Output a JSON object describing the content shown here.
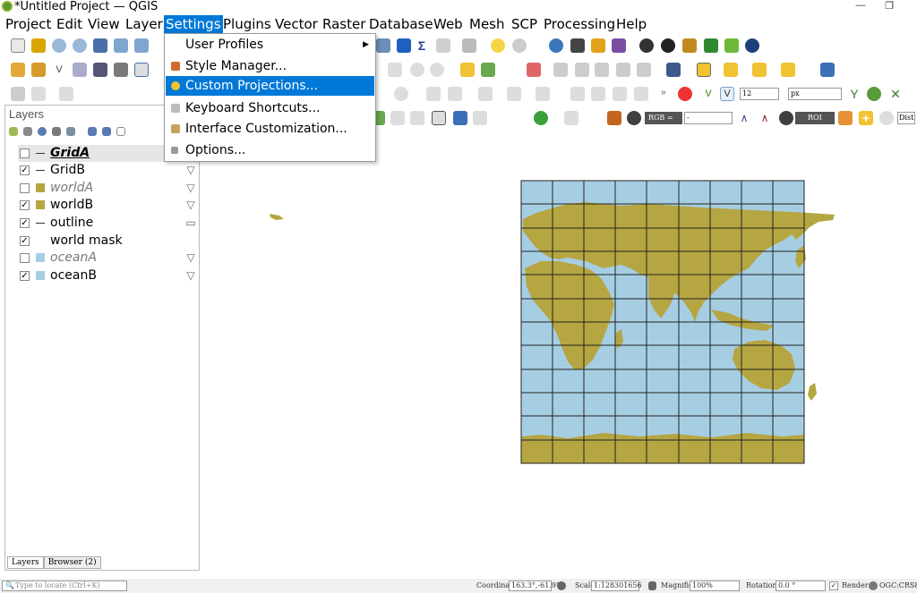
{
  "window": {
    "title": "*Untitled Project — QGIS",
    "minimize_glyph": "—",
    "restore_glyph": "❐"
  },
  "menubar": [
    {
      "key": "project",
      "label": "Project"
    },
    {
      "key": "edit",
      "label": "Edit"
    },
    {
      "key": "view",
      "label": "View"
    },
    {
      "key": "layer",
      "label": "Layer"
    },
    {
      "key": "settings",
      "label": "Settings"
    },
    {
      "key": "plugins",
      "label": "Plugins"
    },
    {
      "key": "vector",
      "label": "Vector"
    },
    {
      "key": "raster",
      "label": "Raster"
    },
    {
      "key": "database",
      "label": "Database"
    },
    {
      "key": "web",
      "label": "Web"
    },
    {
      "key": "mesh",
      "label": "Mesh"
    },
    {
      "key": "scp",
      "label": "SCP"
    },
    {
      "key": "processing",
      "label": "Processing"
    },
    {
      "key": "help",
      "label": "Help"
    }
  ],
  "settings_menu": [
    {
      "label": "User Profiles",
      "icon": "none",
      "submenu_arrow": "▶"
    },
    {
      "label": "Style Manager...",
      "icon": "style-manager-icon"
    },
    {
      "label": "Custom Projections...",
      "icon": "custom-projection-icon"
    },
    {
      "label": "Keyboard Shortcuts...",
      "icon": "keyboard-icon"
    },
    {
      "label": "Interface Customization...",
      "icon": "customization-icon"
    },
    {
      "label": "Options...",
      "icon": "options-wrench-icon"
    }
  ],
  "toolbar": {
    "font_size_value": "12",
    "font_unit": "px",
    "rgb_label": "RGB =",
    "rgb_value": "-",
    "roi_label": "ROI",
    "dist_label": "Dist"
  },
  "layers_panel": {
    "title": "Layers",
    "layers": [
      {
        "name": "GridA",
        "checked": false,
        "symbol": "line",
        "color": "#333333",
        "filter": false,
        "selected": true
      },
      {
        "name": "GridB",
        "checked": true,
        "symbol": "line",
        "color": "#333333",
        "filter": true,
        "selected": false
      },
      {
        "name": "worldA",
        "checked": false,
        "symbol": "fill",
        "color": "#b5a642",
        "filter": true,
        "selected": false
      },
      {
        "name": "worldB",
        "checked": true,
        "symbol": "fill",
        "color": "#b5a642",
        "filter": true,
        "selected": false
      },
      {
        "name": "outline",
        "checked": true,
        "symbol": "line",
        "color": "#333333",
        "filter": false,
        "selected": false
      },
      {
        "name": "world mask",
        "checked": true,
        "symbol": "none",
        "color": "",
        "filter": false,
        "selected": false
      },
      {
        "name": "oceanA",
        "checked": false,
        "symbol": "fill",
        "color": "#a6cee3",
        "filter": true,
        "selected": false
      },
      {
        "name": "oceanB",
        "checked": true,
        "symbol": "fill",
        "color": "#a6cee3",
        "filter": true,
        "selected": false
      }
    ],
    "tabs": [
      "Layers",
      "Browser (2)"
    ]
  },
  "map": {
    "ocean_color": "#a6cee3",
    "land_color": "#b5a642"
  },
  "statusbar": {
    "locate_placeholder": "Type to locate (Ctrl+K)",
    "coordinate_label": "Coordinate",
    "coordinate_value": "163.3°,-61.9°",
    "scale_label": "Scale",
    "scale_value": "1:128301656",
    "magnifier_label": "Magnifier",
    "magnifier_value": "100%",
    "rotation_label": "Rotation",
    "rotation_value": "0.0 °",
    "render_label": "Render",
    "crs_label": "OGC:CRS84"
  },
  "colors": {
    "accent": "#0078d7",
    "qgis_green": "#589632"
  }
}
